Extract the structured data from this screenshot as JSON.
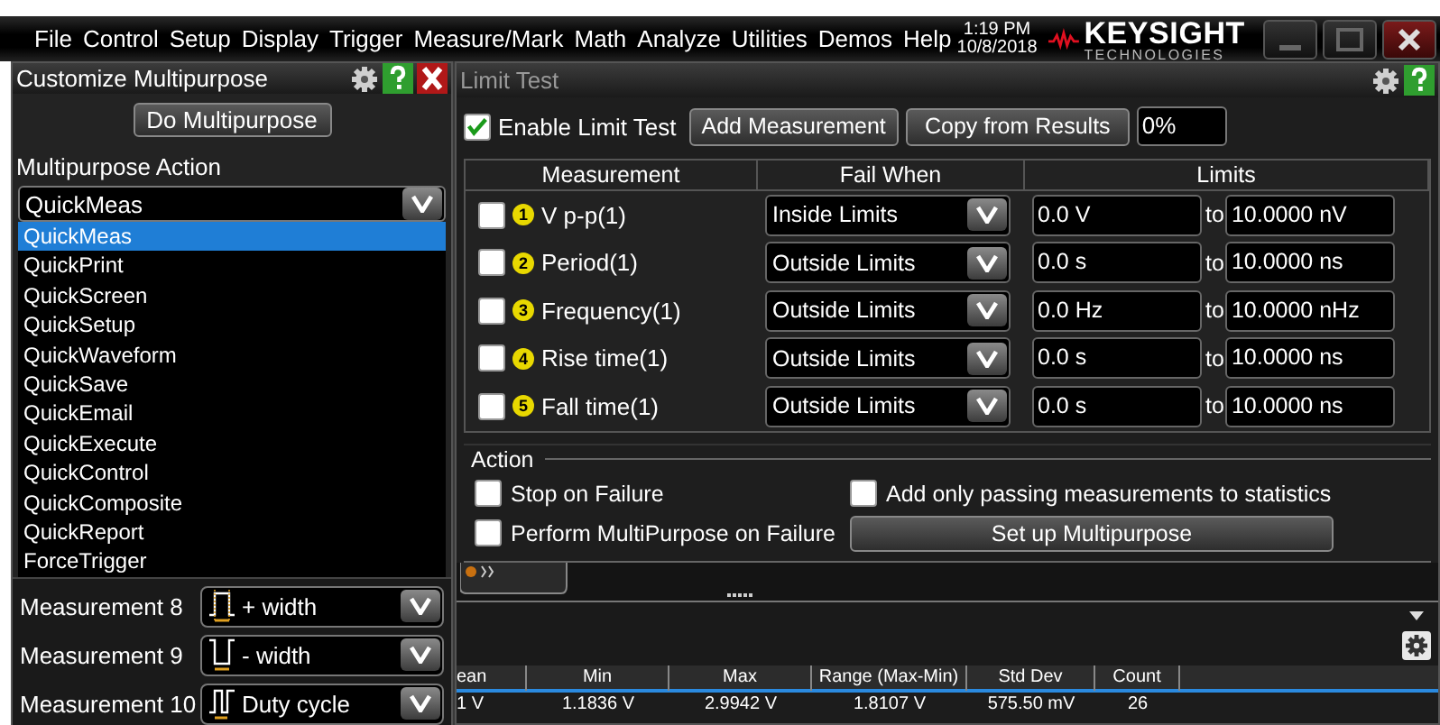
{
  "menu": [
    {
      "label": "File"
    },
    {
      "label": "Control"
    },
    {
      "label": "Setup"
    },
    {
      "label": "Display"
    },
    {
      "label": "Trigger"
    },
    {
      "label": "Measure/Mark"
    },
    {
      "label": "Math"
    },
    {
      "label": "Analyze"
    },
    {
      "label": "Utilities"
    },
    {
      "label": "Demos"
    },
    {
      "label": "Help"
    }
  ],
  "clock": {
    "time": "1:19 PM",
    "date": "10/8/2018"
  },
  "logo": {
    "name": "KEYSIGHT",
    "subtitle": "TECHNOLOGIES"
  },
  "multipurpose_panel": {
    "title": "Customize Multipurpose",
    "button": "Do Multipurpose",
    "action_label": "Multipurpose Action",
    "action_value": "QuickMeas",
    "options": [
      {
        "label": "QuickMeas",
        "selected": true
      },
      {
        "label": "QuickPrint",
        "selected": false
      },
      {
        "label": "QuickScreen",
        "selected": false
      },
      {
        "label": "QuickSetup",
        "selected": false
      },
      {
        "label": "QuickWaveform",
        "selected": false
      },
      {
        "label": "QuickSave",
        "selected": false
      },
      {
        "label": "QuickEmail",
        "selected": false
      },
      {
        "label": "QuickExecute",
        "selected": false
      },
      {
        "label": "QuickControl",
        "selected": false
      },
      {
        "label": "QuickComposite",
        "selected": false
      },
      {
        "label": "QuickReport",
        "selected": false
      },
      {
        "label": "ForceTrigger",
        "selected": false
      }
    ],
    "measurements": [
      {
        "label": "Measurement 8",
        "value": "+ width",
        "kind": "plus-width"
      },
      {
        "label": "Measurement 9",
        "value": "- width",
        "kind": "minus-width"
      },
      {
        "label": "Measurement 10",
        "value": "Duty cycle",
        "kind": "duty-cycle"
      }
    ]
  },
  "limit_test": {
    "title": "Limit Test",
    "enable": {
      "label": "Enable Limit Test",
      "checked": true
    },
    "add_button": "Add Measurement",
    "copy_button": "Copy from Results",
    "percent": "0%",
    "columns": [
      "Measurement",
      "Fail When",
      "Limits"
    ],
    "rows": [
      {
        "checked": false,
        "number": "1",
        "name": "V p-p(1)",
        "fail_when": "Inside Limits",
        "low": "0.0 V",
        "to": "to",
        "high": "10.0000 nV"
      },
      {
        "checked": false,
        "number": "2",
        "name": "Period(1)",
        "fail_when": "Outside Limits",
        "low": "0.0 s",
        "to": "to",
        "high": "10.0000 ns"
      },
      {
        "checked": false,
        "number": "3",
        "name": "Frequency(1)",
        "fail_when": "Outside Limits",
        "low": "0.0 Hz",
        "to": "to",
        "high": "10.0000 nHz"
      },
      {
        "checked": false,
        "number": "4",
        "name": "Rise time(1)",
        "fail_when": "Outside Limits",
        "low": "0.0 s",
        "to": "to",
        "high": "10.0000 ns"
      },
      {
        "checked": false,
        "number": "5",
        "name": "Fall time(1)",
        "fail_when": "Outside Limits",
        "low": "0.0 s",
        "to": "to",
        "high": "10.0000 ns"
      }
    ],
    "action": {
      "title": "Action",
      "stop_on_failure": {
        "label": "Stop on Failure",
        "checked": false
      },
      "add_passing": {
        "label": "Add only passing measurements to statistics",
        "checked": false
      },
      "perform_multipurpose": {
        "label": "Perform MultiPurpose on Failure",
        "checked": false
      },
      "setup_button": "Set up Multipurpose"
    }
  },
  "statistics": {
    "columns": [
      "ean",
      "Min",
      "Max",
      "Range (Max-Min)",
      "Std Dev",
      "Count"
    ],
    "rows": [
      [
        "1 V",
        "1.1836 V",
        "2.9942 V",
        "1.8107 V",
        "575.50 mV",
        "26"
      ]
    ]
  }
}
